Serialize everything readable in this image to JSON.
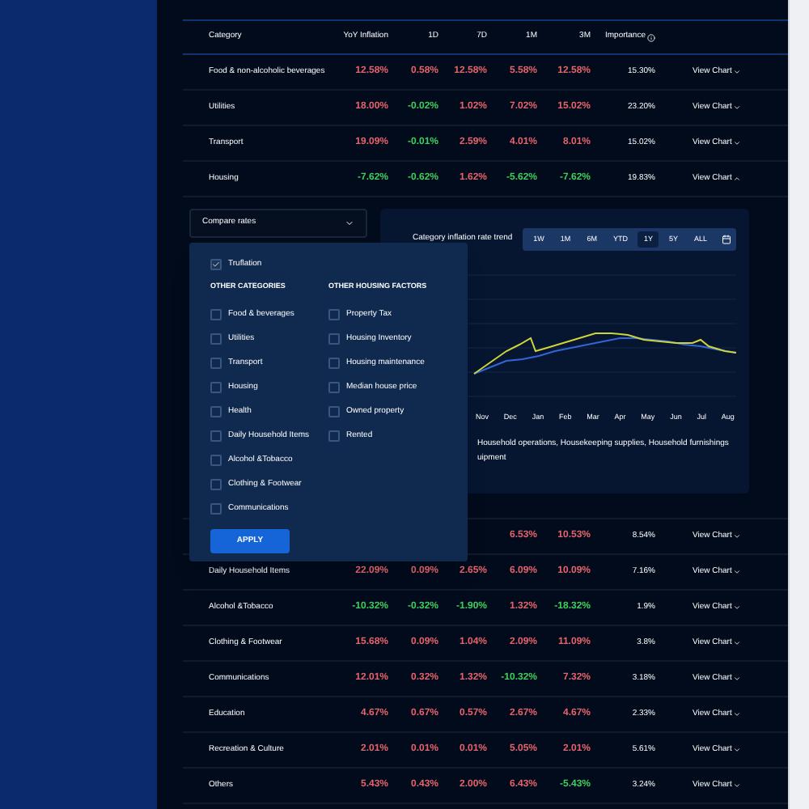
{
  "table": {
    "columns": [
      "Category",
      "YoY Inflation",
      "1D",
      "7D",
      "1M",
      "3M",
      "Importance"
    ],
    "rows_top": [
      {
        "category": "Food & non-alcoholic beverages",
        "cells": [
          {
            "text": "12.58%",
            "color": "#e5636b"
          },
          {
            "text": "0.58%",
            "color": "#e5636b"
          },
          {
            "text": "12.58%",
            "color": "#e5636b"
          },
          {
            "text": "5.58%",
            "color": "#e5636b"
          },
          {
            "text": "12.58%",
            "color": "#e5636b"
          }
        ],
        "importance": "15.30%",
        "action": "View Chart",
        "expanded": false
      },
      {
        "category": "Utilities",
        "cells": [
          {
            "text": "18.00%",
            "color": "#e5636b"
          },
          {
            "text": "-0.02%",
            "color": "#3fcf5c"
          },
          {
            "text": "1.02%",
            "color": "#e5636b"
          },
          {
            "text": "7.02%",
            "color": "#e5636b"
          },
          {
            "text": "15.02%",
            "color": "#e5636b"
          }
        ],
        "importance": "23.20%",
        "action": "View Chart",
        "expanded": false
      },
      {
        "category": "Transport",
        "cells": [
          {
            "text": "19.09%",
            "color": "#e5636b"
          },
          {
            "text": "-0.01%",
            "color": "#3fcf5c"
          },
          {
            "text": "2.59%",
            "color": "#e5636b"
          },
          {
            "text": "4.01%",
            "color": "#e5636b"
          },
          {
            "text": "8.01%",
            "color": "#e5636b"
          }
        ],
        "importance": "15.02%",
        "action": "View Chart",
        "expanded": false
      },
      {
        "category": "Housing",
        "cells": [
          {
            "text": "-7.62%",
            "color": "#3fcf5c"
          },
          {
            "text": "-0.62%",
            "color": "#3fcf5c"
          },
          {
            "text": "1.62%",
            "color": "#e5636b"
          },
          {
            "text": "-5.62%",
            "color": "#3fcf5c"
          },
          {
            "text": "-7.62%",
            "color": "#3fcf5c"
          }
        ],
        "importance": "19.83%",
        "action": "View Chart",
        "expanded": true
      }
    ],
    "rows_bottom": [
      {
        "cells": [
          null,
          null,
          null,
          {
            "text": "6.53%",
            "color": "#e5636b"
          },
          {
            "text": "10.53%",
            "color": "#e5636b"
          }
        ],
        "importance": "8.54%",
        "action": "View Chart",
        "expanded": false
      },
      {
        "category": "Daily Household Items",
        "cells": [
          {
            "text": "22.09%",
            "color": "#e5636b"
          },
          {
            "text": "0.09%",
            "color": "#e5636b"
          },
          {
            "text": "2.65%",
            "color": "#e5636b"
          },
          {
            "text": "6.09%",
            "color": "#e5636b"
          },
          {
            "text": "10.09%",
            "color": "#e5636b"
          }
        ],
        "importance": "7.16%",
        "action": "View Chart",
        "expanded": false
      },
      {
        "category": "Alcohol &Tobacco",
        "cells": [
          {
            "text": "-10.32%",
            "color": "#3fcf5c"
          },
          {
            "text": "-0.32%",
            "color": "#3fcf5c"
          },
          {
            "text": "-1.90%",
            "color": "#3fcf5c"
          },
          {
            "text": "1.32%",
            "color": "#e5636b"
          },
          {
            "text": "-18.32%",
            "color": "#3fcf5c"
          }
        ],
        "importance": "1.9%",
        "action": "View Chart",
        "expanded": false
      },
      {
        "category": "Clothing & Footwear",
        "cells": [
          {
            "text": "15.68%",
            "color": "#e5636b"
          },
          {
            "text": "0.09%",
            "color": "#e5636b"
          },
          {
            "text": "1.04%",
            "color": "#e5636b"
          },
          {
            "text": "2.09%",
            "color": "#e5636b"
          },
          {
            "text": "11.09%",
            "color": "#e5636b"
          }
        ],
        "importance": "3.8%",
        "action": "View Chart",
        "expanded": false
      },
      {
        "category": "Communications",
        "cells": [
          {
            "text": "12.01%",
            "color": "#e5636b"
          },
          {
            "text": "0.32%",
            "color": "#e5636b"
          },
          {
            "text": "1.32%",
            "color": "#e5636b"
          },
          {
            "text": "-10.32%",
            "color": "#3fcf5c"
          },
          {
            "text": "7.32%",
            "color": "#e5636b"
          }
        ],
        "importance": "3.18%",
        "action": "View Chart",
        "expanded": false
      },
      {
        "category": "Education",
        "cells": [
          {
            "text": "4.67%",
            "color": "#e5636b"
          },
          {
            "text": "0.67%",
            "color": "#e5636b"
          },
          {
            "text": "0.57%",
            "color": "#e5636b"
          },
          {
            "text": "2.67%",
            "color": "#e5636b"
          },
          {
            "text": "4.67%",
            "color": "#e5636b"
          }
        ],
        "importance": "2.33%",
        "action": "View Chart",
        "expanded": false
      },
      {
        "category": "Recreation & Culture",
        "cells": [
          {
            "text": "2.01%",
            "color": "#e5636b"
          },
          {
            "text": "0.01%",
            "color": "#e5636b"
          },
          {
            "text": "0.01%",
            "color": "#e5636b"
          },
          {
            "text": "5.05%",
            "color": "#e5636b"
          },
          {
            "text": "2.01%",
            "color": "#e5636b"
          }
        ],
        "importance": "5.61%",
        "action": "View Chart",
        "expanded": false
      },
      {
        "category": "Others",
        "cells": [
          {
            "text": "5.43%",
            "color": "#e5636b"
          },
          {
            "text": "0.43%",
            "color": "#e5636b"
          },
          {
            "text": "2.00%",
            "color": "#e5636b"
          },
          {
            "text": "6.43%",
            "color": "#e5636b"
          },
          {
            "text": "-5.43%",
            "color": "#3fcf5c"
          }
        ],
        "importance": "3.24%",
        "action": "View Chart",
        "expanded": false
      }
    ]
  },
  "compare_dropdown": {
    "label": "Compare rates"
  },
  "compare_menu": {
    "main": {
      "label": "Truflation",
      "checked": true
    },
    "groups": [
      {
        "heading": "OTHER CATEGORIES",
        "items": [
          {
            "label": "Food & beverages",
            "checked": false
          },
          {
            "label": "Utilities",
            "checked": false
          },
          {
            "label": "Transport",
            "checked": false
          },
          {
            "label": "Housing",
            "checked": false
          },
          {
            "label": "Health",
            "checked": false
          },
          {
            "label": "Daily Household Items",
            "checked": false
          },
          {
            "label": "Alcohol &Tobacco",
            "checked": false
          },
          {
            "label": "Clothing & Footwear",
            "checked": false
          },
          {
            "label": "Communications",
            "checked": false
          }
        ]
      },
      {
        "heading": "OTHER HOUSING FACTORS",
        "items": [
          {
            "label": "Property Tax",
            "checked": false
          },
          {
            "label": "Housing Inventory",
            "checked": false
          },
          {
            "label": "Housing maintenance",
            "checked": false
          },
          {
            "label": "Median house price",
            "checked": false
          },
          {
            "label": "Owned property",
            "checked": false
          },
          {
            "label": "Rented",
            "checked": false
          }
        ]
      }
    ],
    "apply": "APPLY"
  },
  "chart_panel": {
    "title": "Category inflation rate trend",
    "ranges": [
      {
        "label": "1W",
        "selected": false
      },
      {
        "label": "1M",
        "selected": false
      },
      {
        "label": "6M",
        "selected": false
      },
      {
        "label": "YTD",
        "selected": false
      },
      {
        "label": "1Y",
        "selected": true
      },
      {
        "label": "5Y",
        "selected": false
      },
      {
        "label": "ALL",
        "selected": false
      }
    ],
    "x_labels": [
      "Nov",
      "Dec",
      "Jan",
      "Feb",
      "Mar",
      "Apr",
      "May",
      "Jun",
      "Jul",
      "Aug"
    ],
    "note_lines": [
      "Household operations, Housekeeping supplies, Household furnishings",
      "uipment"
    ]
  }
}
